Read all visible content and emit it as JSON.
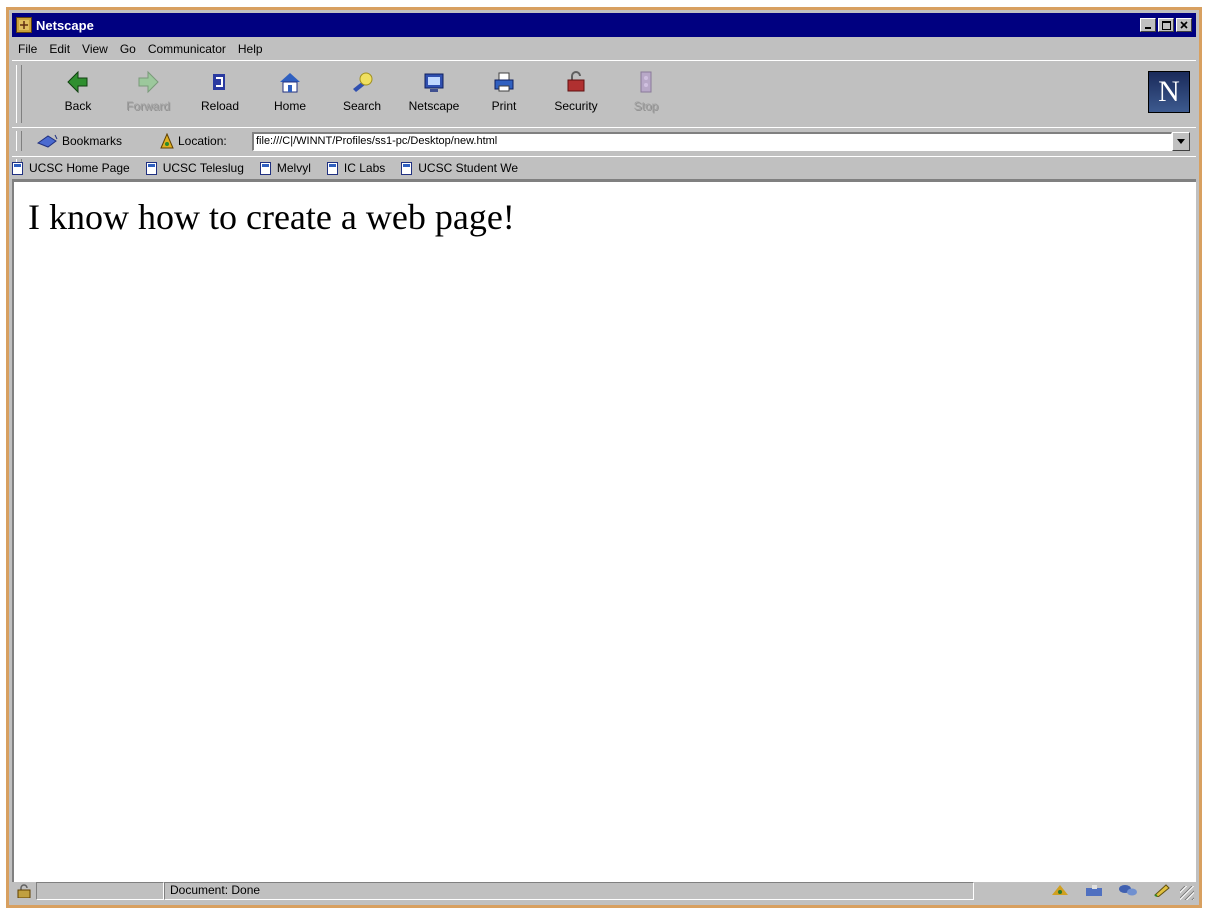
{
  "window": {
    "title": "Netscape",
    "controls": [
      "minimize",
      "maximize",
      "close"
    ]
  },
  "menu": [
    {
      "label": "File",
      "accel": "F"
    },
    {
      "label": "Edit",
      "accel": "E"
    },
    {
      "label": "View",
      "accel": "V"
    },
    {
      "label": "Go",
      "accel": "G"
    },
    {
      "label": "Communicator",
      "accel": "C"
    },
    {
      "label": "Help",
      "accel": "H"
    }
  ],
  "navigation": {
    "back": "Back",
    "forward": "Forward",
    "reload": "Reload",
    "home": "Home",
    "search": "Search",
    "netscape": "Netscape",
    "print": "Print",
    "security": "Security",
    "stop": "Stop",
    "logo": "N"
  },
  "location": {
    "bookmarks_label": "Bookmarks",
    "location_label": "Location:",
    "url": "file:///C|/WINNT/Profiles/ss1-pc/Desktop/new.html"
  },
  "personal_toolbar": [
    "UCSC Home Page",
    "UCSC Teleslug",
    "Melvyl",
    "IC Labs",
    "UCSC Student We"
  ],
  "page": {
    "heading": "I know how to create a web page!"
  },
  "status": {
    "text": "Document: Done"
  },
  "colors": {
    "titlebar": "#000080",
    "chrome": "#c0c0c0",
    "frame_border": "#d8a060",
    "content_bg": "#ffffff"
  }
}
